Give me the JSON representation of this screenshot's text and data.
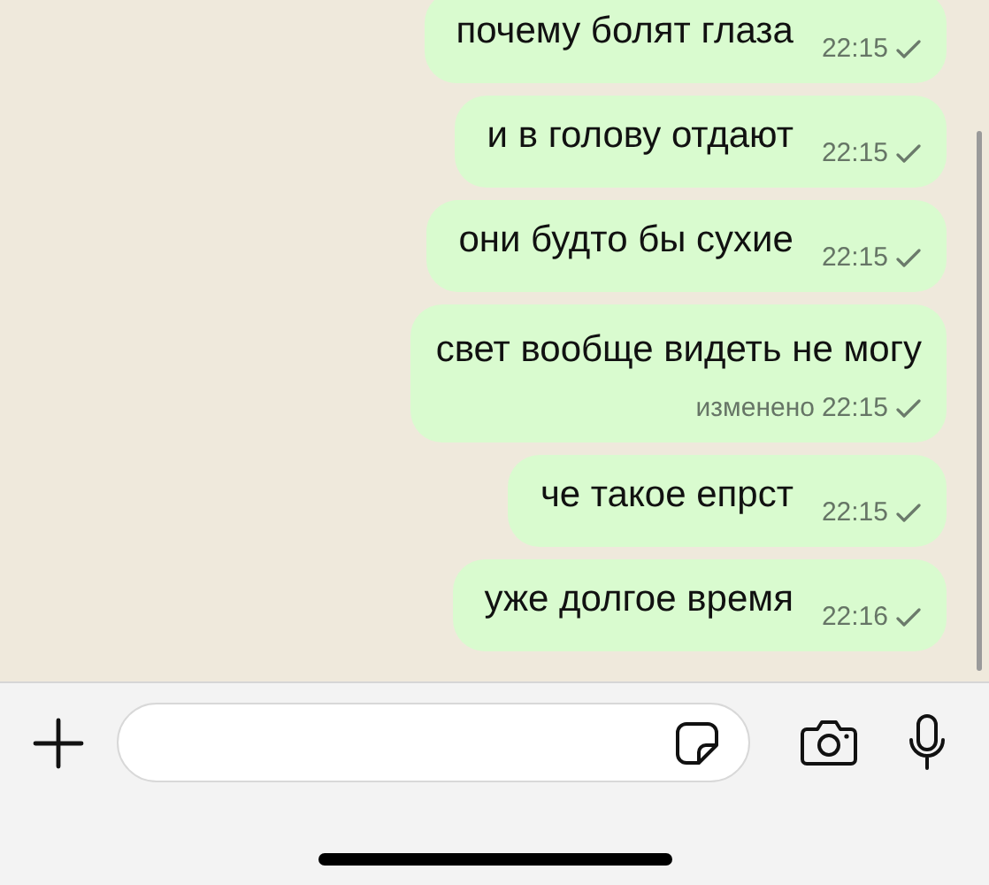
{
  "messages": [
    {
      "text": "почему болят глаза",
      "time": "22:15",
      "read": false
    },
    {
      "text": "и в голову отдают",
      "time": "22:15",
      "read": false
    },
    {
      "text": "они будто бы сухие",
      "time": "22:15",
      "read": false
    },
    {
      "text": "свет вообще видеть не могу",
      "edited": "изменено",
      "time": "22:15",
      "read": false
    },
    {
      "text": "че такое епрст",
      "time": "22:15",
      "read": false
    },
    {
      "text": "уже долгое время",
      "time": "22:16",
      "read": false
    }
  ]
}
